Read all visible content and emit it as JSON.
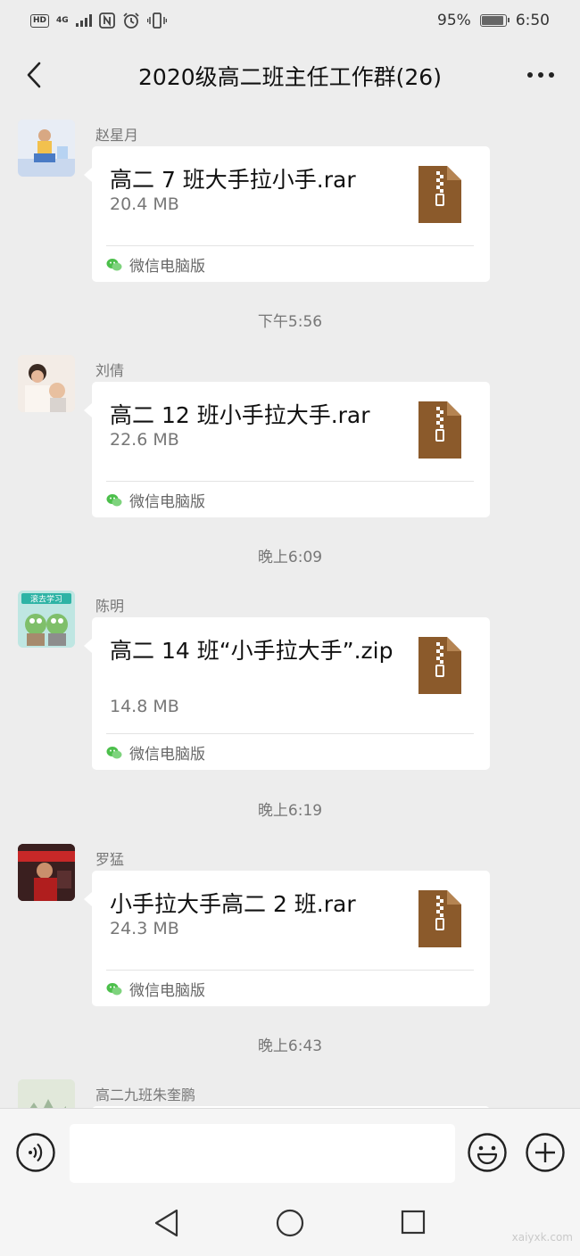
{
  "status_bar": {
    "hd": "HD",
    "network": "4G",
    "battery_text": "95%",
    "battery_level": 0.95,
    "time": "6:50"
  },
  "header": {
    "title": "2020级高二班主任工作群(26)",
    "back_icon": "chevron-left-icon",
    "more_icon": "more-icon"
  },
  "messages": [
    {
      "sender": "赵星月",
      "file_name": "高二 7 班大手拉小手.rar",
      "file_size": "20.4 MB",
      "source": "微信电脑版"
    },
    {
      "sender": "刘倩",
      "file_name": "高二 12 班小手拉大手.rar",
      "file_size": "22.6 MB",
      "source": "微信电脑版"
    },
    {
      "sender": "陈明",
      "file_name": "高二 14 班“小手拉大手”.zip",
      "file_size": "14.8 MB",
      "source": "微信电脑版"
    },
    {
      "sender": "罗猛",
      "file_name": "小手拉大手高二 2 班.rar",
      "file_size": "24.3 MB",
      "source": "微信电脑版"
    },
    {
      "sender": "高二九班朱奎鹏"
    }
  ],
  "timestamps": [
    "下午5:56",
    "晚上6:09",
    "晚上6:19",
    "晚上6:43"
  ],
  "avatar4_text": "滚去学习",
  "input_bar": {
    "voice_icon": "voice-icon",
    "emoji_icon": "emoji-icon",
    "plus_icon": "plus-icon"
  },
  "watermark": "xaiyxk.com",
  "colors": {
    "background": "#ededed",
    "bubble": "#ffffff",
    "zip_icon": "#8b5a2b",
    "wechat_green": "#4cbf4b"
  }
}
